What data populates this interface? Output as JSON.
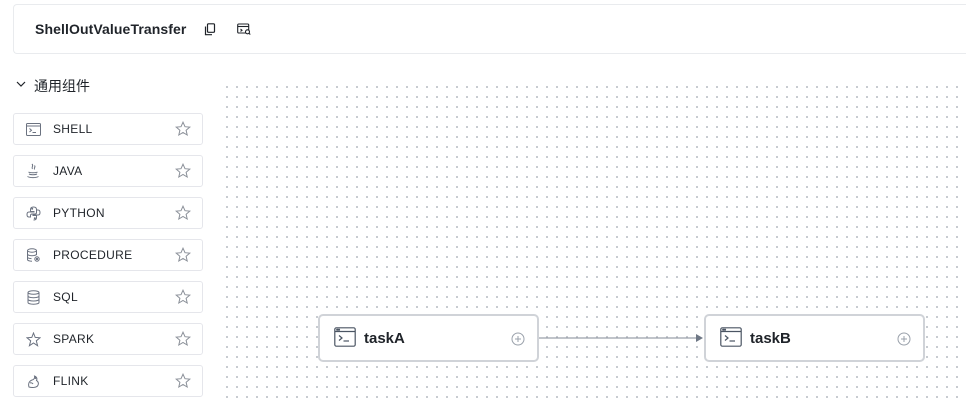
{
  "header": {
    "workflow_name": "ShellOutValueTransfer",
    "copy_icon": "copy-icon",
    "view_icon": "code-view-icon"
  },
  "palette": {
    "group_label": "通用组件",
    "expanded": true,
    "items": [
      {
        "label": "SHELL",
        "icon": "terminal-icon",
        "favorite": false
      },
      {
        "label": "JAVA",
        "icon": "java-icon",
        "favorite": false
      },
      {
        "label": "PYTHON",
        "icon": "python-icon",
        "favorite": false
      },
      {
        "label": "PROCEDURE",
        "icon": "database-gear-icon",
        "favorite": false
      },
      {
        "label": "SQL",
        "icon": "database-icon",
        "favorite": false
      },
      {
        "label": "SPARK",
        "icon": "spark-star-icon",
        "favorite": false
      },
      {
        "label": "FLINK",
        "icon": "flink-squirrel-icon",
        "favorite": false
      }
    ]
  },
  "canvas": {
    "nodes": [
      {
        "label": "taskA",
        "type": "SHELL"
      },
      {
        "label": "taskB",
        "type": "SHELL"
      }
    ],
    "edges": [
      {
        "from": "taskA",
        "to": "taskB"
      }
    ]
  },
  "colors": {
    "border": "#e5e6eb",
    "node_border": "#d0d3d8",
    "edge": "#9aa1ab",
    "icon": "#6b7280"
  }
}
